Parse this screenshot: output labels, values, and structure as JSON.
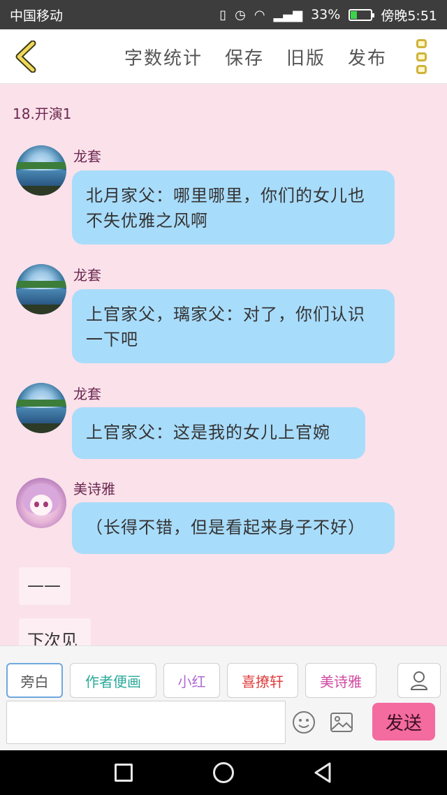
{
  "status_bar": {
    "carrier": "中国移动",
    "battery_text": "33%",
    "time": "傍晚5:51",
    "battery_level": 0.33
  },
  "header": {
    "back_icon": "chevron-left-icon",
    "actions": [
      "字数统计",
      "保存",
      "旧版",
      "发布"
    ],
    "more_icon": "more-vertical-icon"
  },
  "chat": {
    "chapter_title": "18.开演1",
    "messages": [
      {
        "speaker": "龙套",
        "text": "北月家父：哪里哪里，你们的女儿也不失优雅之风啊"
      },
      {
        "speaker": "龙套",
        "text": "上官家父，璃家父：对了，你们认识一下吧"
      },
      {
        "speaker": "龙套",
        "text": "上官家父：这是我的女儿上官婉"
      },
      {
        "speaker": "美诗雅",
        "text": "（长得不错，但是看起来身子不好）"
      }
    ],
    "narrations": [
      "——",
      "下次见"
    ]
  },
  "toolbar": {
    "roles": [
      {
        "label": "旁白",
        "color": "#555555"
      },
      {
        "label": "作者便画",
        "color": "#2aa99a"
      },
      {
        "label": "小红",
        "color": "#b06ad0"
      },
      {
        "label": "喜撩轩",
        "color": "#e03c3c"
      },
      {
        "label": "美诗雅",
        "color": "#d04aa0"
      }
    ],
    "input_placeholder": "",
    "send_label": "发送"
  },
  "colors": {
    "chat_bg": "#fbe1ea",
    "bubble": "#a8dcfb",
    "send_button": "#f46ba0",
    "speaker_name": "#6b2850"
  }
}
